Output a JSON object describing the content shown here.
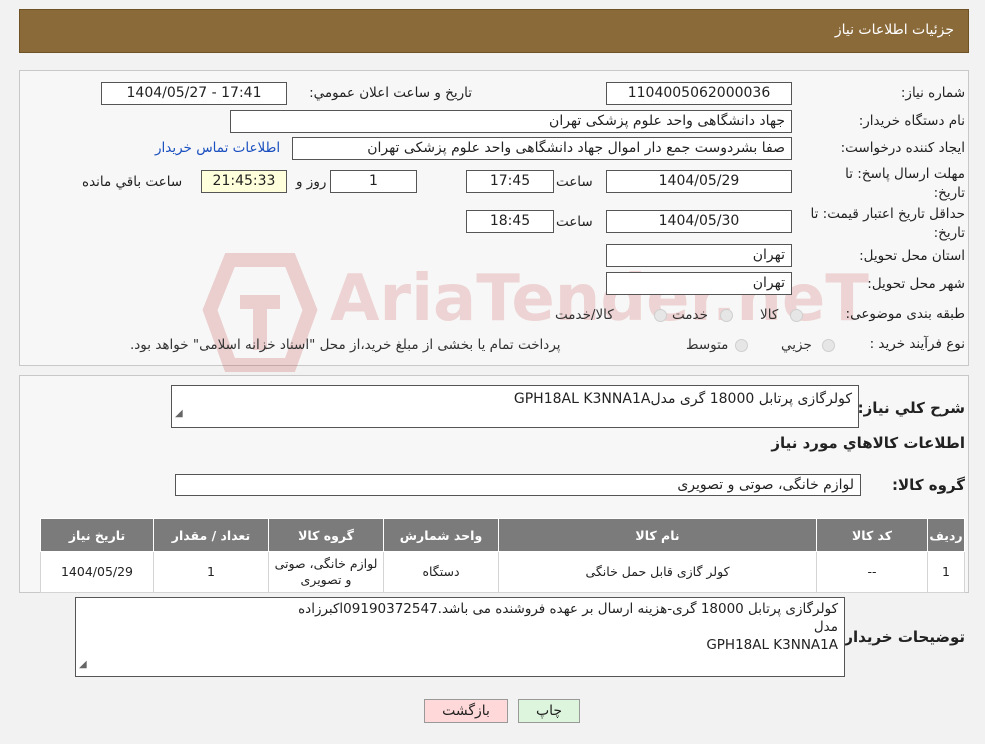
{
  "header": {
    "title": "جزئیات اطلاعات نیاز"
  },
  "fields": {
    "need_number_label": "شماره نیاز:",
    "need_number": "1104005062000036",
    "announce_label": "تاریخ و ساعت اعلان عمومي:",
    "announce_value": "1404/05/27 - 17:41",
    "buyer_org_label": "نام دستگاه خريدار:",
    "buyer_org": "جهاد دانشگاهی واحد علوم پزشکی تهران",
    "creator_label": "ايجاد کننده درخواست:",
    "creator": "صفا بشردوست جمع دار اموال  جهاد دانشگاهی واحد علوم پزشکی تهران",
    "contact_link": "اطلاعات تماس خريدار",
    "reply_deadline_label": "مهلت ارسال پاسخ: تا تاريخ:",
    "reply_date": "1404/05/29",
    "time_label": "ساعت",
    "reply_time": "17:45",
    "days_value": "1",
    "days_label": "روز و",
    "remaining_value": "21:45:33",
    "remaining_label": "ساعت باقي مانده",
    "price_validity_label": "حداقل تاريخ اعتبار قيمت: تا تاريخ:",
    "price_date": "1404/05/30",
    "price_time": "18:45",
    "province_label": "استان محل تحويل:",
    "province": "تهران",
    "city_label": "شهر محل تحويل:",
    "city": "تهران",
    "category_label": "طبقه بندی موضوعی:",
    "category_options": [
      "کالا",
      "خدمت",
      "کالا/خدمت"
    ],
    "process_label": "نوع فرآيند خريد :",
    "process_options": [
      "جزيي",
      "متوسط"
    ],
    "process_note": "پرداخت تمام یا بخشی از مبلغ خرید،از محل \"اسناد خزانه اسلامی\" خواهد بود."
  },
  "summary": {
    "label": "شرح کلي نياز:",
    "value": "کولرگازی پرتابل 18000 گری مدلGPH18AL K3NNA1A",
    "goods_info_title": "اطلاعات کالاهاي مورد نياز",
    "group_label": "گروه کالا:",
    "group_value": "لوازم خانگی، صوتی و تصویری"
  },
  "table": {
    "headers": [
      "رديف",
      "کد کالا",
      "نام کالا",
      "واحد شمارش",
      "گروه کالا",
      "تعداد / مقدار",
      "تاريخ نياز"
    ],
    "rows": [
      [
        "1",
        "--",
        "کولر گازی قابل حمل خانگی",
        "دستگاه",
        "لوازم خانگی، صوتی و تصویری",
        "1",
        "1404/05/29"
      ]
    ]
  },
  "buyer_notes": {
    "label": "توضيحات خريدار:",
    "line1": "کولرگازی پرتابل 18000 گری-هزینه ارسال بر عهده فروشنده می باشد.09190372547اکبرزاده",
    "line2": "مدل",
    "line3": "GPH18AL K3NNA1A"
  },
  "buttons": {
    "print": "چاپ",
    "back": "بازگشت"
  },
  "watermark": {
    "text": "AriaTender.neT"
  },
  "colors": {
    "header_bg": "#8b6a3a",
    "table_header_bg": "#7b7b7b",
    "link": "#1a4fbf",
    "back_btn_bg": "#ffd9d9",
    "print_btn_bg": "#dcf5dc"
  }
}
